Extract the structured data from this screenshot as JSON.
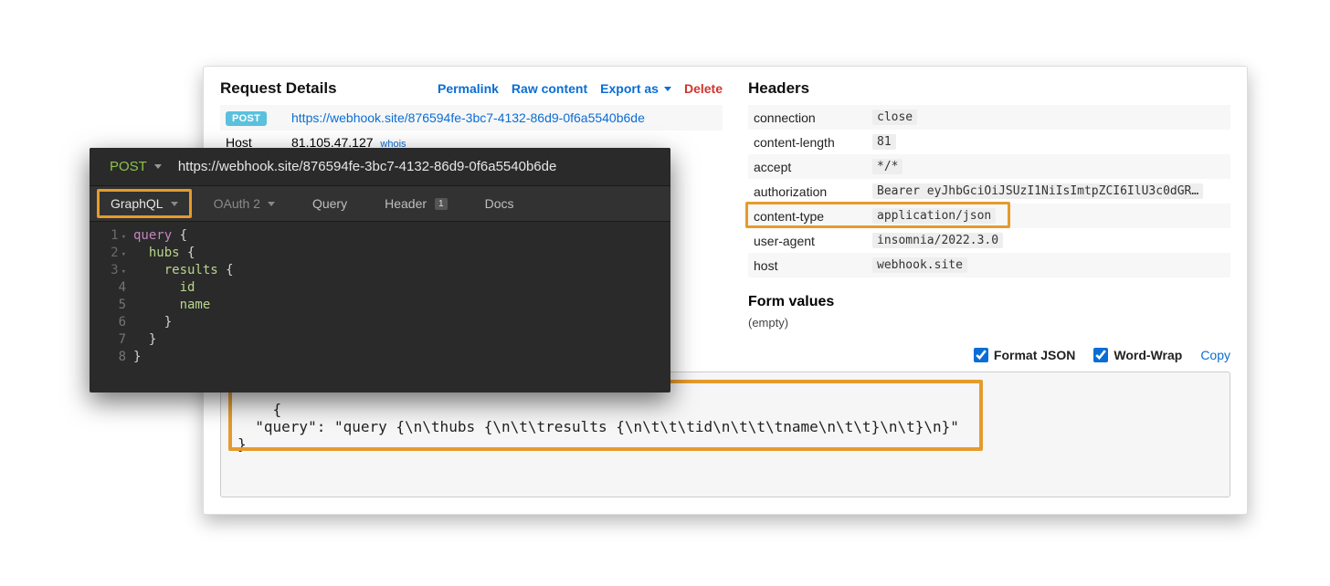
{
  "panel": {
    "request_details_title": "Request Details",
    "links": {
      "permalink": "Permalink",
      "raw_content": "Raw content",
      "export_as": "Export as",
      "delete": "Delete"
    },
    "method_badge": "POST",
    "url": "https://webhook.site/876594fe-3bc7-4132-86d9-0f6a5540b6de",
    "host_label": "Host",
    "host_value": "81.105.47.127",
    "whois_label": "whois"
  },
  "headers": {
    "title": "Headers",
    "rows": [
      {
        "key": "connection",
        "value": "close"
      },
      {
        "key": "content-length",
        "value": "81"
      },
      {
        "key": "accept",
        "value": "*/*"
      },
      {
        "key": "authorization",
        "value": "Bearer eyJhbGciOiJSUzI1NiIsImtpZCI6IlU3c0dGR…"
      },
      {
        "key": "content-type",
        "value": "application/json"
      },
      {
        "key": "user-agent",
        "value": "insomnia/2022.3.0"
      },
      {
        "key": "host",
        "value": "webhook.site"
      }
    ]
  },
  "form_values": {
    "title": "Form values",
    "empty": "(empty)"
  },
  "options": {
    "format_json": "Format JSON",
    "word_wrap": "Word-Wrap",
    "copy": "Copy"
  },
  "body": "{\n  \"query\": \"query {\\n\\thubs {\\n\\t\\tresults {\\n\\t\\t\\tid\\n\\t\\t\\tname\\n\\t\\t}\\n\\t}\\n}\"\n}",
  "insomnia": {
    "method": "POST",
    "url": "https://webhook.site/876594fe-3bc7-4132-86d9-0f6a5540b6de",
    "tabs": {
      "graphql": "GraphQL",
      "oauth": "OAuth 2",
      "query": "Query",
      "header": "Header",
      "header_badge": "1",
      "docs": "Docs"
    },
    "editor": {
      "line1_kw": "query",
      "line2": "hubs",
      "line3": "results",
      "line4": "id",
      "line5": "name"
    }
  }
}
